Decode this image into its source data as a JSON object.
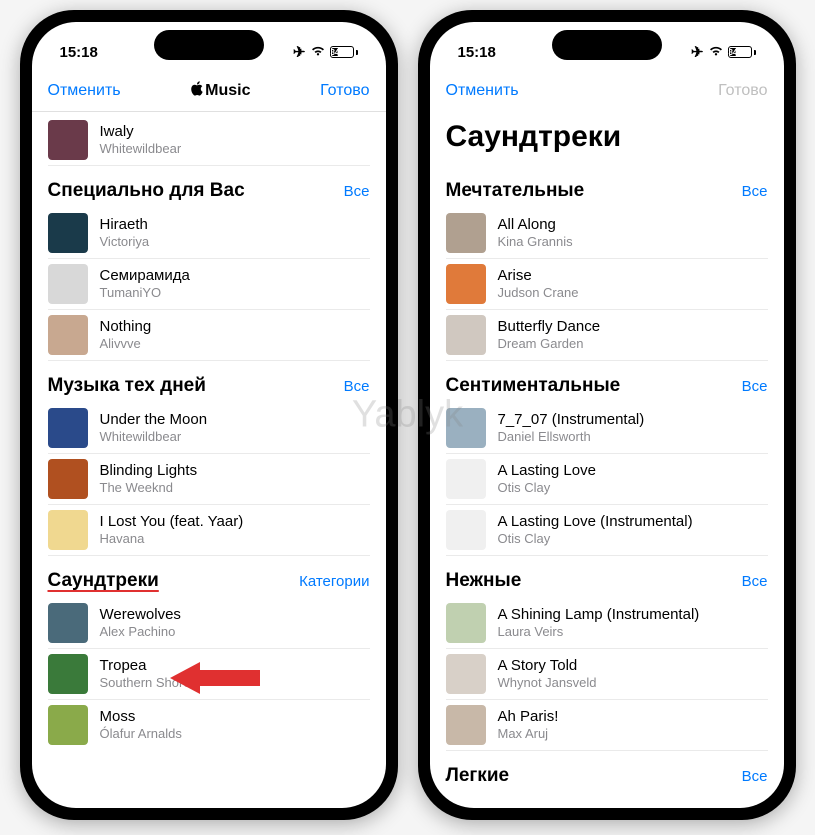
{
  "watermark": "Yablyk",
  "status": {
    "time": "15:18",
    "battery": "34"
  },
  "left": {
    "nav": {
      "cancel": "Отменить",
      "title": "Music",
      "done": "Готово"
    },
    "topRow": {
      "track": "Iwaly",
      "artist": "Whitewildbear"
    },
    "sections": [
      {
        "title": "Специально для Вас",
        "link": "Все",
        "items": [
          {
            "track": "Hiraeth",
            "artist": "Victoriya",
            "color": "#1a3a4a"
          },
          {
            "track": "Семирамида",
            "artist": "TumaniYO",
            "color": "#d8d8d8"
          },
          {
            "track": "Nothing",
            "artist": "Alivvve",
            "color": "#c8a890"
          }
        ]
      },
      {
        "title": "Музыка тех дней",
        "link": "Все",
        "items": [
          {
            "track": "Under the Moon",
            "artist": "Whitewildbear",
            "color": "#2a4a8a"
          },
          {
            "track": "Blinding Lights",
            "artist": "The Weeknd",
            "color": "#b05020"
          },
          {
            "track": "I Lost You (feat. Yaar)",
            "artist": "Havana",
            "color": "#f0d890"
          }
        ]
      },
      {
        "title": "Саундтреки",
        "link": "Категории",
        "underline": true,
        "items": [
          {
            "track": "Werewolves",
            "artist": "Alex Pachino",
            "color": "#4a6a7a"
          },
          {
            "track": "Tropea",
            "artist": "Southern Shores",
            "color": "#3a7a3a"
          },
          {
            "track": "Moss",
            "artist": "Ólafur Arnalds",
            "color": "#8aaa4a"
          }
        ]
      }
    ]
  },
  "right": {
    "nav": {
      "cancel": "Отменить",
      "done": "Готово"
    },
    "bigTitle": "Саундтреки",
    "sections": [
      {
        "title": "Мечтательные",
        "link": "Все",
        "items": [
          {
            "track": "All Along",
            "artist": "Kina Grannis",
            "color": "#b0a090"
          },
          {
            "track": "Arise",
            "artist": "Judson Crane",
            "color": "#e07a3a"
          },
          {
            "track": "Butterfly Dance",
            "artist": "Dream Garden",
            "color": "#d0c8c0"
          }
        ]
      },
      {
        "title": "Сентиментальные",
        "link": "Все",
        "items": [
          {
            "track": "7_7_07 (Instrumental)",
            "artist": "Daniel Ellsworth",
            "color": "#9ab0c0"
          },
          {
            "track": "A Lasting Love",
            "artist": "Otis Clay",
            "color": "#f0f0f0"
          },
          {
            "track": "A Lasting Love (Instrumental)",
            "artist": "Otis Clay",
            "color": "#f0f0f0"
          }
        ]
      },
      {
        "title": "Нежные",
        "link": "Все",
        "items": [
          {
            "track": "A Shining Lamp (Instrumental)",
            "artist": "Laura Veirs",
            "color": "#c0d0b0"
          },
          {
            "track": "A Story Told",
            "artist": "Whynot Jansveld",
            "color": "#d8d0c8"
          },
          {
            "track": "Ah Paris!",
            "artist": "Max Aruj",
            "color": "#c8b8a8"
          }
        ]
      },
      {
        "title": "Легкие",
        "link": "Все",
        "items": []
      }
    ]
  }
}
